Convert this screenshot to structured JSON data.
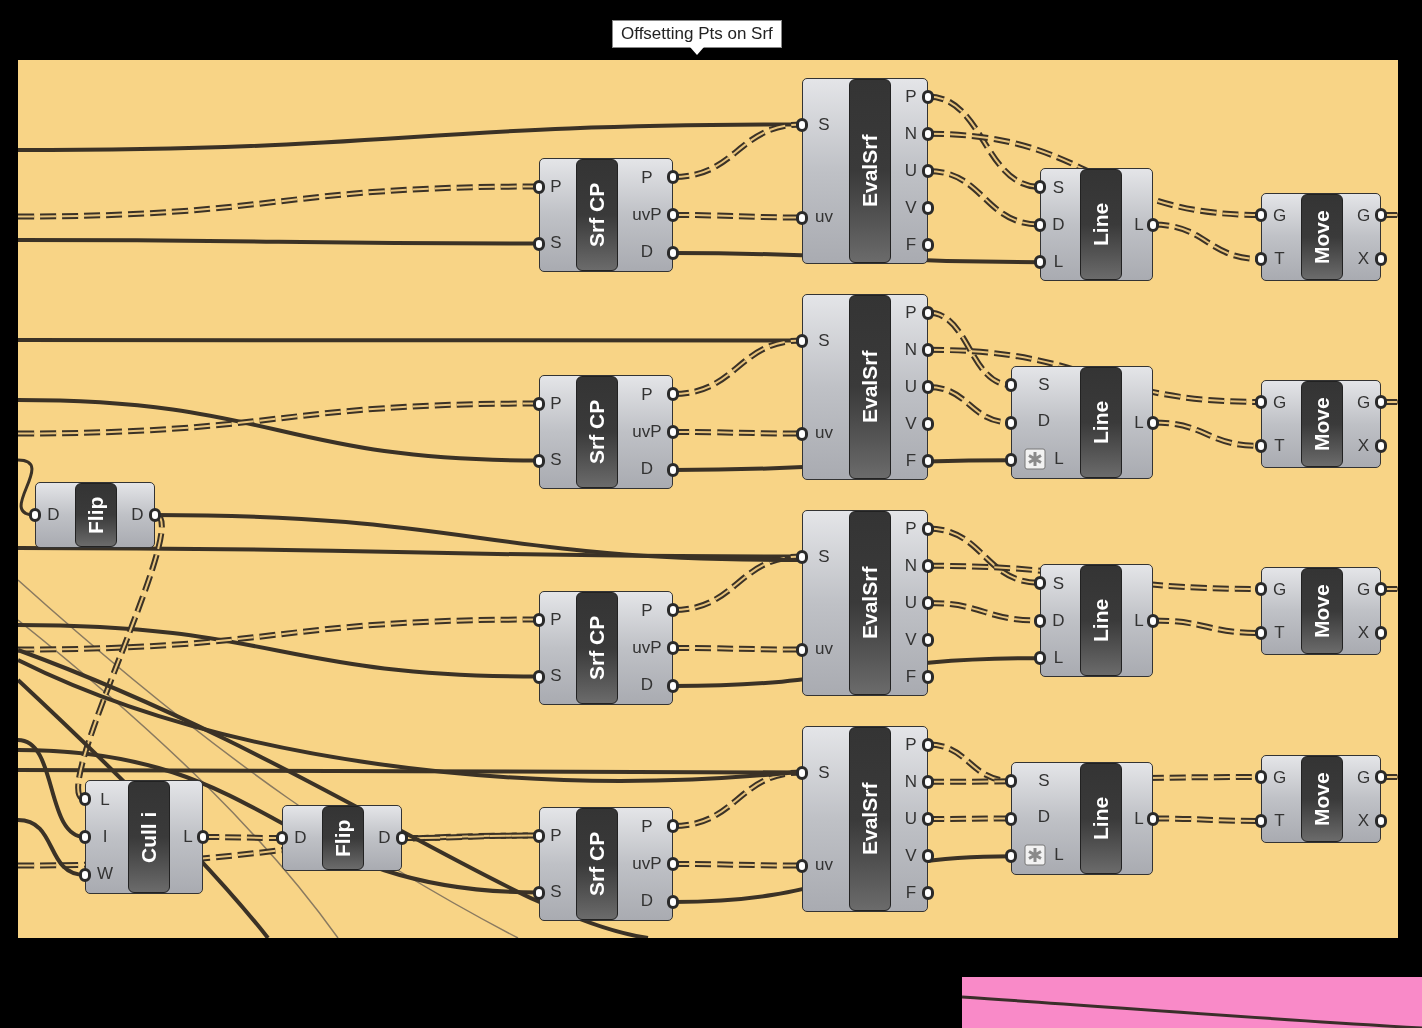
{
  "group": {
    "title": "Offsetting Pts on Srf"
  },
  "components": [
    {
      "name": "EvalSrf",
      "inputs": [
        {
          "label": "S",
          "flagged": false
        },
        {
          "label": "uv",
          "flagged": false
        }
      ],
      "outputs": [
        "P",
        "N",
        "U",
        "V",
        "F"
      ]
    },
    {
      "name": "Srf CP",
      "inputs": [
        {
          "label": "P",
          "flagged": false
        },
        {
          "label": "S",
          "flagged": false
        }
      ],
      "outputs": [
        "P",
        "uvP",
        "D"
      ]
    },
    {
      "name": "Line",
      "inputs": [
        {
          "label": "S",
          "flagged": false
        },
        {
          "label": "D",
          "flagged": false
        },
        {
          "label": "L",
          "flagged": false
        }
      ],
      "outputs": [
        "L"
      ]
    },
    {
      "name": "Move",
      "inputs": [
        {
          "label": "G",
          "flagged": false
        },
        {
          "label": "T",
          "flagged": false
        }
      ],
      "outputs": [
        "G",
        "X"
      ]
    },
    {
      "name": "EvalSrf",
      "inputs": [
        {
          "label": "S",
          "flagged": false
        },
        {
          "label": "uv",
          "flagged": false
        }
      ],
      "outputs": [
        "P",
        "N",
        "U",
        "V",
        "F"
      ]
    },
    {
      "name": "Line",
      "inputs": [
        {
          "label": "S",
          "flagged": false
        },
        {
          "label": "D",
          "flagged": false
        },
        {
          "label": "L",
          "flagged": true
        }
      ],
      "outputs": [
        "L"
      ]
    },
    {
      "name": "Srf CP",
      "inputs": [
        {
          "label": "P",
          "flagged": false
        },
        {
          "label": "S",
          "flagged": false
        }
      ],
      "outputs": [
        "P",
        "uvP",
        "D"
      ]
    },
    {
      "name": "Move",
      "inputs": [
        {
          "label": "G",
          "flagged": false
        },
        {
          "label": "T",
          "flagged": false
        }
      ],
      "outputs": [
        "G",
        "X"
      ]
    },
    {
      "name": "Flip",
      "inputs": [
        {
          "label": "D",
          "flagged": false
        }
      ],
      "outputs": [
        "D"
      ]
    },
    {
      "name": "EvalSrf",
      "inputs": [
        {
          "label": "S",
          "flagged": false
        },
        {
          "label": "uv",
          "flagged": false
        }
      ],
      "outputs": [
        "P",
        "N",
        "U",
        "V",
        "F"
      ]
    },
    {
      "name": "Line",
      "inputs": [
        {
          "label": "S",
          "flagged": false
        },
        {
          "label": "D",
          "flagged": false
        },
        {
          "label": "L",
          "flagged": false
        }
      ],
      "outputs": [
        "L"
      ]
    },
    {
      "name": "Move",
      "inputs": [
        {
          "label": "G",
          "flagged": false
        },
        {
          "label": "T",
          "flagged": false
        }
      ],
      "outputs": [
        "G",
        "X"
      ]
    },
    {
      "name": "Srf CP",
      "inputs": [
        {
          "label": "P",
          "flagged": false
        },
        {
          "label": "S",
          "flagged": false
        }
      ],
      "outputs": [
        "P",
        "uvP",
        "D"
      ]
    },
    {
      "name": "EvalSrf",
      "inputs": [
        {
          "label": "S",
          "flagged": false
        },
        {
          "label": "uv",
          "flagged": false
        }
      ],
      "outputs": [
        "P",
        "N",
        "U",
        "V",
        "F"
      ]
    },
    {
      "name": "Move",
      "inputs": [
        {
          "label": "G",
          "flagged": false
        },
        {
          "label": "T",
          "flagged": false
        }
      ],
      "outputs": [
        "G",
        "X"
      ]
    },
    {
      "name": "Line",
      "inputs": [
        {
          "label": "S",
          "flagged": false
        },
        {
          "label": "D",
          "flagged": false
        },
        {
          "label": "L",
          "flagged": true
        }
      ],
      "outputs": [
        "L"
      ]
    },
    {
      "name": "Cull i",
      "inputs": [
        {
          "label": "L",
          "flagged": false
        },
        {
          "label": "I",
          "flagged": false
        },
        {
          "label": "W",
          "flagged": false
        }
      ],
      "outputs": [
        "L"
      ]
    },
    {
      "name": "Flip",
      "inputs": [
        {
          "label": "D",
          "flagged": false
        }
      ],
      "outputs": [
        "D"
      ]
    },
    {
      "name": "Srf CP",
      "inputs": [
        {
          "label": "P",
          "flagged": false
        },
        {
          "label": "S",
          "flagged": false
        }
      ],
      "outputs": [
        "P",
        "uvP",
        "D"
      ]
    }
  ]
}
